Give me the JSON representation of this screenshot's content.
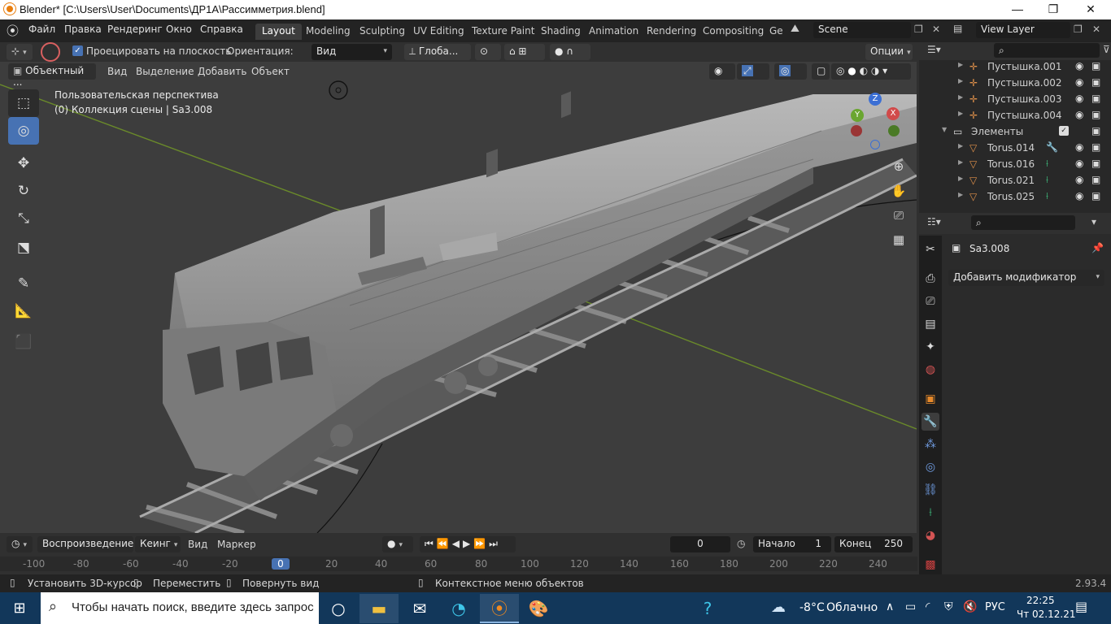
{
  "window": {
    "title": "Blender* [C:\\Users\\User\\Documents\\ДР1А\\Рассимметрия.blend]",
    "minimize": "—",
    "maximize": "❐",
    "close": "✕"
  },
  "menubar": {
    "items": [
      "Файл",
      "Правка",
      "Рендеринг",
      "Окно",
      "Справка"
    ],
    "workspaces": [
      "Layout",
      "Modeling",
      "Sculpting",
      "UV Editing",
      "Texture Paint",
      "Shading",
      "Animation",
      "Rendering",
      "Compositing",
      "Ge"
    ],
    "active_workspace": "Layout",
    "scene": "Scene",
    "view_layer": "View Layer"
  },
  "viewport_header": {
    "project_checkbox_label": "Проецировать на плоскость",
    "project_checked": true,
    "orientation_label": "Ориентация:",
    "orientation_value": "Вид",
    "transform_value": "Глоба...",
    "options_label": "Опции"
  },
  "viewport_menu": {
    "mode": "Объектный ...",
    "items": [
      "Вид",
      "Выделение",
      "Добавить",
      "Объект"
    ]
  },
  "viewport_overlay": {
    "perspective": "Пользовательская перспектива",
    "collection": "(0) Коллекция сцены | Sa3.008"
  },
  "gizmo": {
    "x": "X",
    "y": "Y",
    "z": "Z"
  },
  "outliner": {
    "rows": [
      {
        "name": "Пустышка.001",
        "type": "empty",
        "indent": 1
      },
      {
        "name": "Пустышка.002",
        "type": "empty",
        "indent": 1
      },
      {
        "name": "Пустышка.003",
        "type": "empty",
        "indent": 1
      },
      {
        "name": "Пустышка.004",
        "type": "empty",
        "indent": 1
      },
      {
        "name": "Элементы",
        "type": "collection",
        "indent": 0
      },
      {
        "name": "Torus.014",
        "type": "mesh",
        "indent": 1
      },
      {
        "name": "Torus.016",
        "type": "mesh",
        "indent": 1
      },
      {
        "name": "Torus.021",
        "type": "mesh",
        "indent": 1
      },
      {
        "name": "Torus.025",
        "type": "mesh",
        "indent": 1
      }
    ]
  },
  "properties": {
    "object_name": "Sa3.008",
    "add_modifier": "Добавить модификатор"
  },
  "timeline": {
    "playback": "Воспроизведение",
    "keying": "Кеинг",
    "view": "Вид",
    "marker": "Маркер",
    "current_frame": "0",
    "start_label": "Начало",
    "start_value": "1",
    "end_label": "Конец",
    "end_value": "250",
    "ruler": [
      "-100",
      "-80",
      "-60",
      "-40",
      "-20",
      "0",
      "20",
      "40",
      "60",
      "80",
      "100",
      "120",
      "140",
      "160",
      "180",
      "200",
      "220",
      "240"
    ]
  },
  "statusbar": {
    "hint1": "Установить 3D-курсор",
    "hint2": "Переместить",
    "hint3": "Повернуть вид",
    "hint4": "Контекстное меню объектов",
    "version": "2.93.4"
  },
  "taskbar": {
    "search_placeholder": "Чтобы начать поиск, введите здесь запрос",
    "weather_temp": "-8°C",
    "weather_desc": "Облачно",
    "lang": "РУС",
    "time": "22:25",
    "date": "Чт 02.12.21"
  }
}
